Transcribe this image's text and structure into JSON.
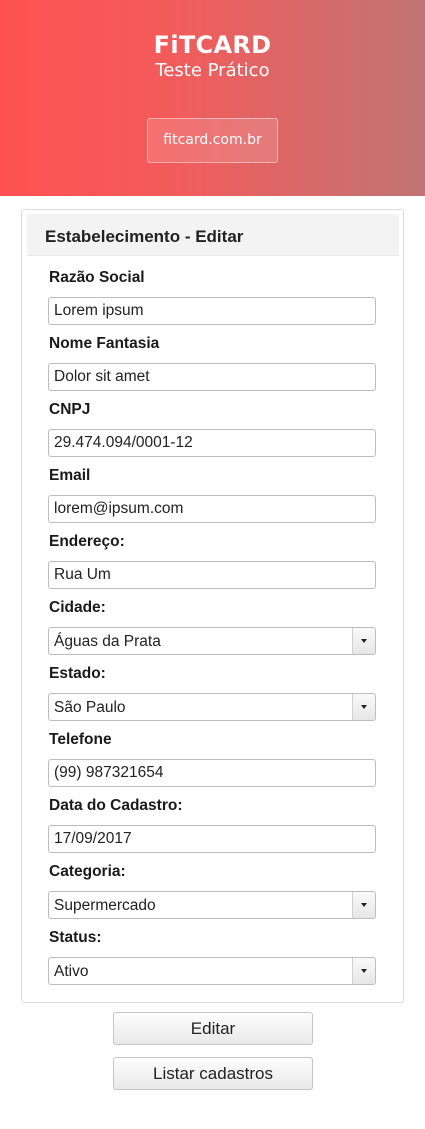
{
  "header": {
    "brand": "FiTCARD",
    "subtitle": "Teste Prático",
    "site_link": "fitcard.com.br"
  },
  "panel": {
    "title": "Estabelecimento - Editar"
  },
  "form": {
    "razao_social": {
      "label": "Razão Social",
      "value": "Lorem ipsum"
    },
    "nome_fantasia": {
      "label": "Nome Fantasia",
      "value": "Dolor sit amet"
    },
    "cnpj": {
      "label": "CNPJ",
      "value": "29.474.094/0001-12"
    },
    "email": {
      "label": "Email",
      "value": "lorem@ipsum.com"
    },
    "endereco": {
      "label": "Endereço:",
      "value": "Rua Um"
    },
    "cidade": {
      "label": "Cidade:",
      "value": "Águas da Prata"
    },
    "estado": {
      "label": "Estado:",
      "value": "São Paulo"
    },
    "telefone": {
      "label": "Telefone",
      "value": "(99) 987321654"
    },
    "data_cadastro": {
      "label": "Data do Cadastro:",
      "value": "17/09/2017"
    },
    "categoria": {
      "label": "Categoria:",
      "value": "Supermercado"
    },
    "status": {
      "label": "Status:",
      "value": "Ativo"
    }
  },
  "actions": {
    "edit_label": "Editar",
    "list_label": "Listar cadastros"
  },
  "colors": {
    "header_start": "#fe5151",
    "header_end": "#c07574"
  },
  "icons": {
    "dropdown": "chevron-down-icon"
  }
}
